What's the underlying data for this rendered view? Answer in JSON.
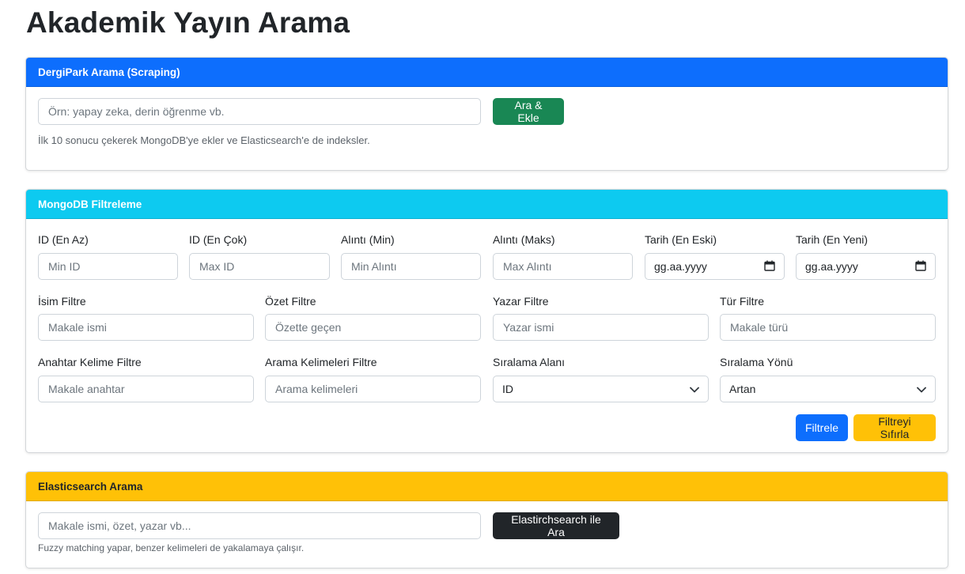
{
  "page": {
    "title": "Akademik Yayın Arama"
  },
  "dergipark": {
    "header": "DergiPark Arama (Scraping)",
    "search_placeholder": "Örn: yapay zeka, derin öğrenme vb.",
    "button_label": "Ara & Ekle",
    "help_text": "İlk 10 sonucu çekerek MongoDB'ye ekler ve Elasticsearch'e de indeksler."
  },
  "mongo": {
    "header": "MongoDB Filtreleme",
    "fields": {
      "id_min": {
        "label": "ID (En Az)",
        "placeholder": "Min ID"
      },
      "id_max": {
        "label": "ID (En Çok)",
        "placeholder": "Max ID"
      },
      "citation_min": {
        "label": "Alıntı (Min)",
        "placeholder": "Min Alıntı"
      },
      "citation_max": {
        "label": "Alıntı (Maks)",
        "placeholder": "Max Alıntı"
      },
      "date_oldest": {
        "label": "Tarih (En Eski)",
        "value": "gg.aa.yyyy"
      },
      "date_newest": {
        "label": "Tarih (En Yeni)",
        "value": "gg.aa.yyyy"
      },
      "name": {
        "label": "İsim Filtre",
        "placeholder": "Makale ismi"
      },
      "summary": {
        "label": "Özet Filtre",
        "placeholder": "Özette geçen"
      },
      "author": {
        "label": "Yazar Filtre",
        "placeholder": "Yazar ismi"
      },
      "type": {
        "label": "Tür Filtre",
        "placeholder": "Makale türü"
      },
      "keyword": {
        "label": "Anahtar Kelime Filtre",
        "placeholder": "Makale anahtar"
      },
      "search_terms": {
        "label": "Arama Kelimeleri Filtre",
        "placeholder": "Arama kelimeleri"
      },
      "sort_field": {
        "label": "Sıralama Alanı",
        "value": "ID"
      },
      "sort_direction": {
        "label": "Sıralama Yönü",
        "value": "Artan"
      }
    },
    "filter_button": "Filtrele",
    "reset_button": "Filtreyi Sıfırla"
  },
  "elastic": {
    "header": "Elasticsearch Arama",
    "search_placeholder": "Makale ismi, özet, yazar vb...",
    "button_label": "Elastirchsearch ile Ara",
    "help_text": "Fuzzy matching yapar, benzer kelimeleri de yakalamaya çalışır."
  },
  "icons": {
    "calendar": "calendar-icon",
    "chevron": "chevron-down-icon"
  },
  "colors": {
    "primary": "#0d6efd",
    "info": "#0dcaf0",
    "warning": "#ffc107",
    "success": "#198754",
    "dark": "#212529"
  }
}
